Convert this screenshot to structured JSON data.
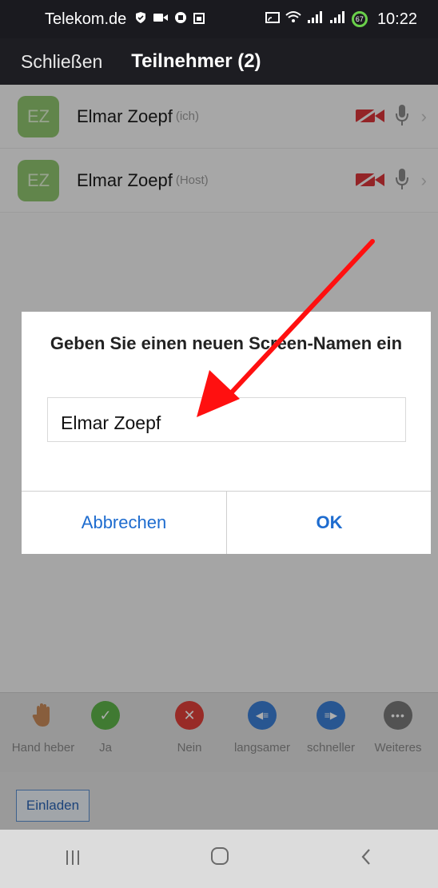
{
  "status_bar": {
    "carrier": "Telekom.de",
    "battery_level": "67",
    "time": "10:22"
  },
  "header": {
    "close_label": "Schließen",
    "title": "Teilnehmer (2)"
  },
  "participants": [
    {
      "initials": "EZ",
      "name": "Elmar Zoepf",
      "tag": "(ich)"
    },
    {
      "initials": "EZ",
      "name": "Elmar Zoepf",
      "tag": "(Host)"
    }
  ],
  "dialog": {
    "title": "Geben Sie einen neuen Screen-Namen ein",
    "input_value": "Elmar Zoepf",
    "cancel_label": "Abbrechen",
    "ok_label": "OK"
  },
  "reactions": [
    {
      "label": "Hand heber",
      "icon": "hand-icon",
      "color": "#c98b5a"
    },
    {
      "label": "Ja",
      "icon": "check-icon",
      "color": "#5fb44a"
    },
    {
      "label": "Nein",
      "icon": "x-icon",
      "color": "#e0403a"
    },
    {
      "label": "langsamer",
      "icon": "rewind-icon",
      "color": "#3c7fd6"
    },
    {
      "label": "schneller",
      "icon": "fast-forward-icon",
      "color": "#3c7fd6"
    },
    {
      "label": "Weiteres",
      "icon": "more-icon",
      "color": "#7a7a7a"
    }
  ],
  "invite_label": "Einladen",
  "nav": {
    "recents": "recents-icon",
    "home": "home-icon",
    "back": "back-icon"
  }
}
